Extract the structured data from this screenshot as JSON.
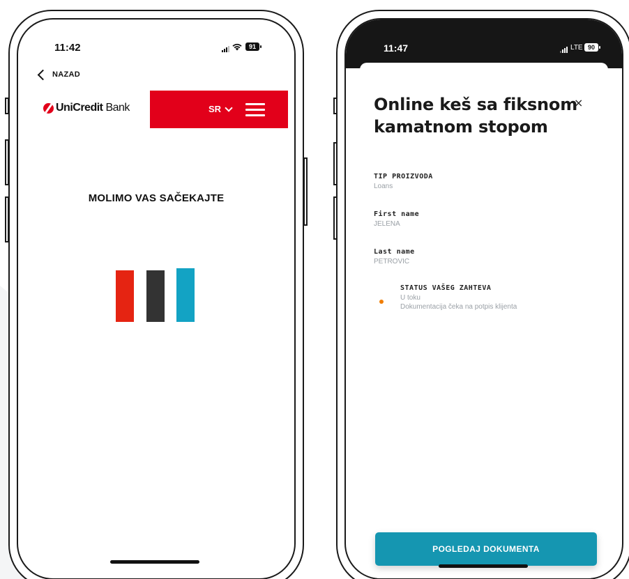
{
  "left_screen": {
    "status_bar": {
      "time": "11:42",
      "battery": "91"
    },
    "nav": {
      "back_label": "NAZAD"
    },
    "header": {
      "brand_name_bold": "UniCredit",
      "brand_name_regular": " Bank",
      "language": "SR"
    },
    "message": "MOLIMO VAS SAČEKAJTE",
    "loader": {
      "colors": [
        "#e52412",
        "#333333",
        "#13a3c4"
      ]
    }
  },
  "right_screen": {
    "status_bar": {
      "time": "11:47",
      "network": "LTE",
      "battery": "90"
    },
    "sheet": {
      "title": "Online keš sa fiksnom kamatnom stopom",
      "close_glyph": "×",
      "fields": [
        {
          "label": "TIP PROIZVODA",
          "value": "Loans"
        },
        {
          "label": "First name",
          "value": "JELENA"
        },
        {
          "label": "Last name",
          "value": "PETROVIC"
        }
      ],
      "status": {
        "label": "STATUS VAŠEG ZAHTEVA",
        "value": "U toku",
        "description": "Dokumentacija čeka na potpis klijenta",
        "dot_color": "#f07d00"
      },
      "cta_label": "POGLEDAJ DOKUMENTA"
    }
  },
  "colors": {
    "brand_red": "#e2001a",
    "accent_teal": "#1596b1"
  }
}
